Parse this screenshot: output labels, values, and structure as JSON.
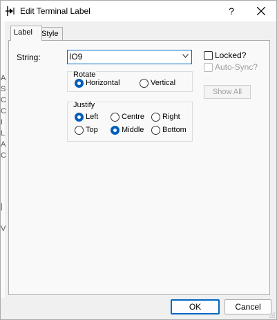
{
  "window": {
    "title": "Edit Terminal Label",
    "help_label": "?",
    "title_icon": "terminal-label-icon",
    "close_icon": "close-icon"
  },
  "background_chars": [
    "A",
    "S",
    "C",
    "C",
    "I",
    "L",
    "A",
    "C",
    "|",
    "V"
  ],
  "tabs": [
    {
      "label": "Label",
      "active": true
    },
    {
      "label": "Style",
      "active": false
    }
  ],
  "string": {
    "label": "String:",
    "value": "IO9"
  },
  "rotate": {
    "title": "Rotate",
    "options": [
      {
        "label": "Horizontal",
        "checked": true
      },
      {
        "label": "Vertical",
        "checked": false
      }
    ]
  },
  "justify": {
    "title": "Justify",
    "options": [
      {
        "label": "Left",
        "checked": true
      },
      {
        "label": "Centre",
        "checked": false
      },
      {
        "label": "Right",
        "checked": false
      },
      {
        "label": "Top",
        "checked": false
      },
      {
        "label": "Middle",
        "checked": true
      },
      {
        "label": "Bottom",
        "checked": false
      }
    ]
  },
  "locked": {
    "label": "Locked?",
    "checked": false
  },
  "autosync": {
    "label": "Auto-Sync?",
    "checked": false,
    "enabled": false
  },
  "show_all_label": "Show All",
  "buttons": {
    "ok": "OK",
    "cancel": "Cancel"
  },
  "colors": {
    "accent": "#005fb8",
    "focus_border": "#0067c0"
  }
}
